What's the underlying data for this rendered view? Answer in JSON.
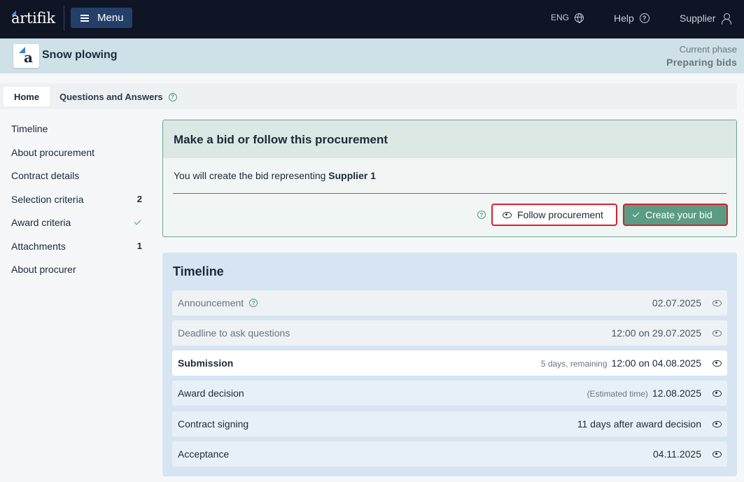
{
  "topbar": {
    "logo": "artifik",
    "menu_label": "Menu",
    "lang": "ENG",
    "help": "Help",
    "user": "Supplier"
  },
  "procurement": {
    "title": "Snow plowing",
    "icon_letter": "a",
    "phase_label": "Current phase",
    "phase_value": "Preparing bids"
  },
  "tabs": [
    {
      "label": "Home",
      "active": true
    },
    {
      "label": "Questions and Answers",
      "active": false
    }
  ],
  "sidenav": [
    {
      "label": "Timeline",
      "count": ""
    },
    {
      "label": "About procurement",
      "count": ""
    },
    {
      "label": "Contract details",
      "count": ""
    },
    {
      "label": "Selection criteria",
      "count": "2"
    },
    {
      "label": "Award criteria",
      "count": "",
      "check": true
    },
    {
      "label": "Attachments",
      "count": "1"
    },
    {
      "label": "About procurer",
      "count": ""
    }
  ],
  "bid": {
    "heading": "Make a bid or follow this procurement",
    "text_prefix": "You will create the bid representing",
    "supplier": "Supplier 1",
    "follow_label": "Follow procurement",
    "create_label": "Create your bid",
    "help_glyph": "?"
  },
  "timeline": {
    "title": "Timeline",
    "rows": [
      {
        "label": "Announcement",
        "note": "",
        "value": "02.07.2025",
        "state": "past",
        "help": true
      },
      {
        "label": "Deadline to ask questions",
        "note": "",
        "value": "12:00 on 29.07.2025",
        "state": "past"
      },
      {
        "label": "Submission",
        "note": "5 days, remaining",
        "value": "12:00 on 04.08.2025",
        "state": "current"
      },
      {
        "label": "Award decision",
        "note": "(Estimated time)",
        "value": "12.08.2025",
        "state": "future"
      },
      {
        "label": "Contract signing",
        "note": "",
        "value": "11 days after award decision",
        "state": "future"
      },
      {
        "label": "Acceptance",
        "note": "",
        "value": "04.11.2025",
        "state": "future"
      }
    ]
  },
  "colors": {
    "topbar": "#0f1525",
    "accent_green": "#5b9c84",
    "highlight_red": "#d9202e"
  }
}
